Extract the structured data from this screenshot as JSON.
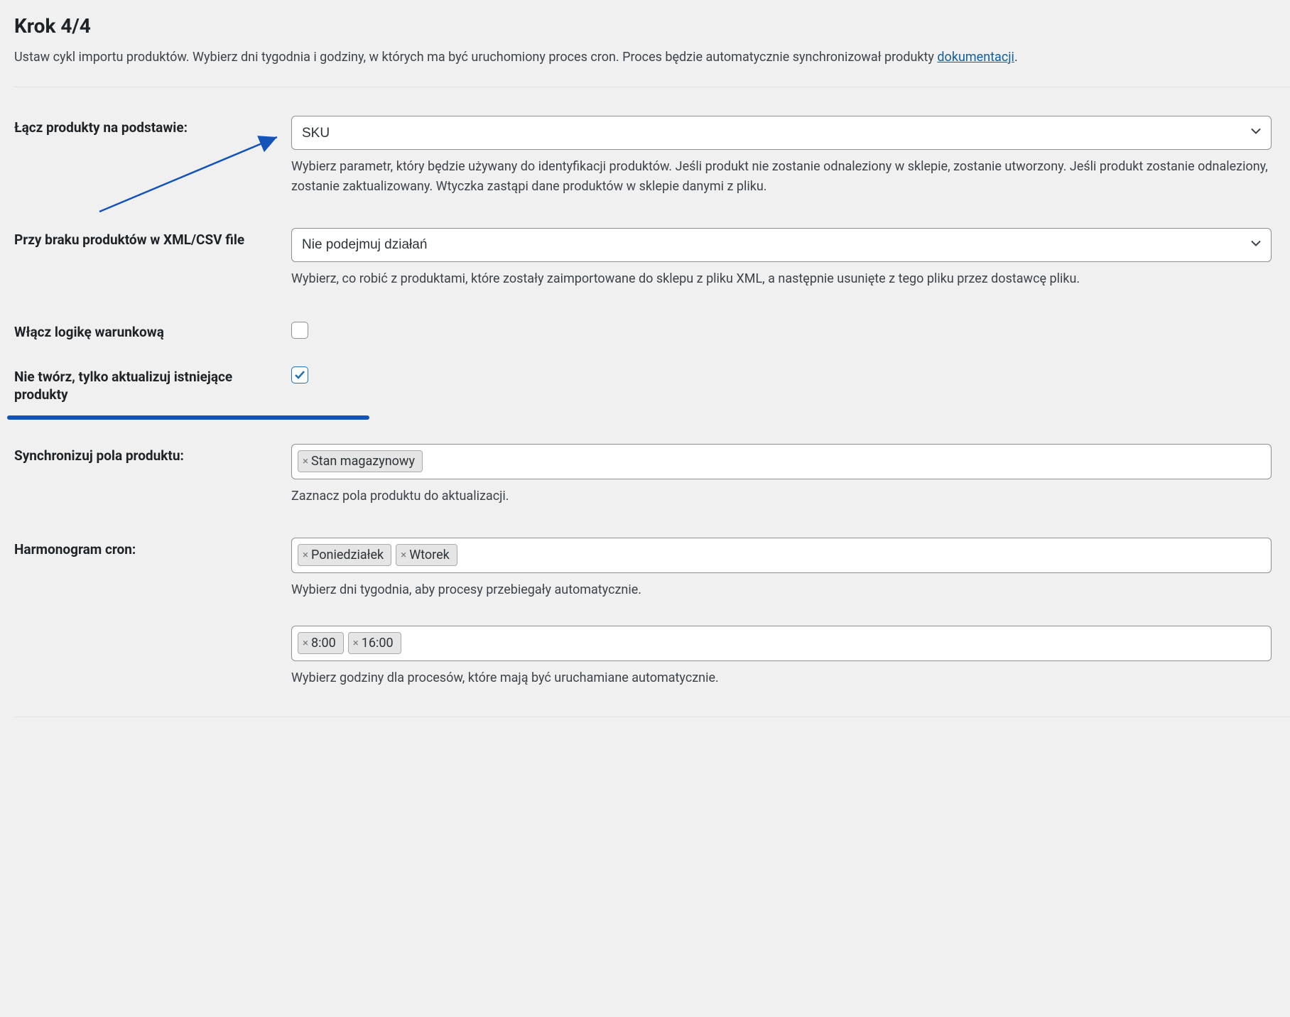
{
  "title": "Krok 4/4",
  "intro_text": "Ustaw cykl importu produktów. Wybierz dni tygodnia i godziny, w których ma być uruchomiony proces cron. Proces będzie automatycznie synchronizował produkty",
  "intro_link": "dokumentacji",
  "fields": {
    "link_products": {
      "label": "Łącz produkty na podstawie:",
      "value": "SKU",
      "help": "Wybierz parametr, który będzie używany do identyfikacji produktów. Jeśli produkt nie zostanie odnaleziony w sklepie, zostanie utworzony. Jeśli produkt zostanie odnaleziony, zostanie zaktualizowany. Wtyczka zastąpi dane produktów w sklepie danymi z pliku."
    },
    "missing_products": {
      "label": "Przy braku produktów w XML/CSV file",
      "value": "Nie podejmuj działań",
      "help": "Wybierz, co robić z produktami, które zostały zaimportowane do sklepu z pliku XML, a następnie usunięte z tego pliku przez dostawcę pliku."
    },
    "conditional_logic": {
      "label": "Włącz logikę warunkową",
      "checked": false
    },
    "only_update": {
      "label": "Nie twórz, tylko aktualizuj istniejące produkty",
      "checked": true
    },
    "sync_fields": {
      "label": "Synchronizuj pola produktu:",
      "tags": [
        "Stan magazynowy"
      ],
      "help": "Zaznacz pola produktu do aktualizacji."
    },
    "cron_schedule": {
      "label": "Harmonogram cron:",
      "days": [
        "Poniedziałek",
        "Wtorek"
      ],
      "days_help": "Wybierz dni tygodnia, aby procesy przebiegały automatycznie.",
      "hours": [
        "8:00",
        "16:00"
      ],
      "hours_help": "Wybierz godziny dla procesów, które mają być uruchamiane automatycznie."
    }
  }
}
